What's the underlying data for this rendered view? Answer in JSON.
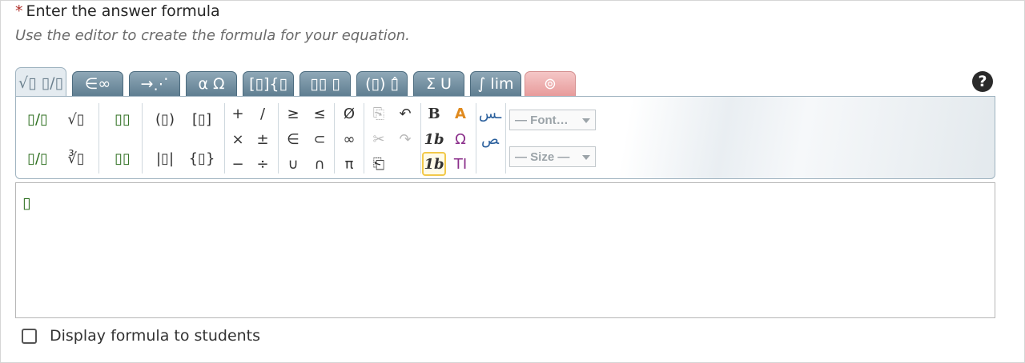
{
  "question": {
    "required_mark": "*",
    "title": "Enter the answer formula",
    "subtitle": "Use the editor to create the formula for your equation."
  },
  "tabs": [
    {
      "label": "√▯ ▯/▯",
      "name": "tab-radicals-fractions",
      "state": "active"
    },
    {
      "label": "∈∞",
      "name": "tab-symbols",
      "state": "normal"
    },
    {
      "label": "→⋰",
      "name": "tab-arrows",
      "state": "normal"
    },
    {
      "label": "α Ω",
      "name": "tab-greek",
      "state": "normal"
    },
    {
      "label": "[▯]{▯",
      "name": "tab-matrices",
      "state": "normal"
    },
    {
      "label": "▯▯ ▯",
      "name": "tab-scripts",
      "state": "normal"
    },
    {
      "label": "(▯) ▯̂",
      "name": "tab-brackets-accents",
      "state": "normal"
    },
    {
      "label": "Σ U",
      "name": "tab-operators",
      "state": "normal"
    },
    {
      "label": "∫ lim",
      "name": "tab-calculus",
      "state": "normal"
    },
    {
      "label": "⊚",
      "name": "tab-chemistry",
      "state": "disabled"
    }
  ],
  "help_label": "?",
  "toolbar": {
    "fraction": "▯/▯",
    "sqrt": "√▯",
    "superscript": "▯▯",
    "parens": "(▯)",
    "brackets": "[▯]",
    "inline_fraction": "▯/▯",
    "nth_root": "∛▯",
    "subscript": "▯▯",
    "abs": "|▯|",
    "braces": "{▯}",
    "plus": "+",
    "slash": "/",
    "times": "×",
    "plusminus": "±",
    "minus": "−",
    "divide": "÷",
    "geq": "≥",
    "leq": "≤",
    "in": "∈",
    "subset": "⊂",
    "cup": "∪",
    "cap": "∩",
    "emptyset": "Ø",
    "infinity": "∞",
    "pi": "π",
    "copy": "⎘",
    "undo": "↶",
    "cut": "✂",
    "redo": "↷",
    "paste": "⎗",
    "bold": "B",
    "color": "A",
    "italic": "1b",
    "special_chars": "Ω",
    "text_mode": "1b",
    "text_cursor": "TI",
    "rtl_1": "ـس",
    "rtl_2": "ﺺ",
    "font_placeholder": "— Font…",
    "size_placeholder": "— Size —"
  },
  "editor": {
    "placeholder_box": "▯"
  },
  "display_option": {
    "label": "Display formula to students",
    "checked": false
  },
  "colors": {
    "tab": "#5f7e91",
    "active_tab": "#e4ebf0",
    "required": "#b0322c",
    "green": "#2c6e1e"
  }
}
